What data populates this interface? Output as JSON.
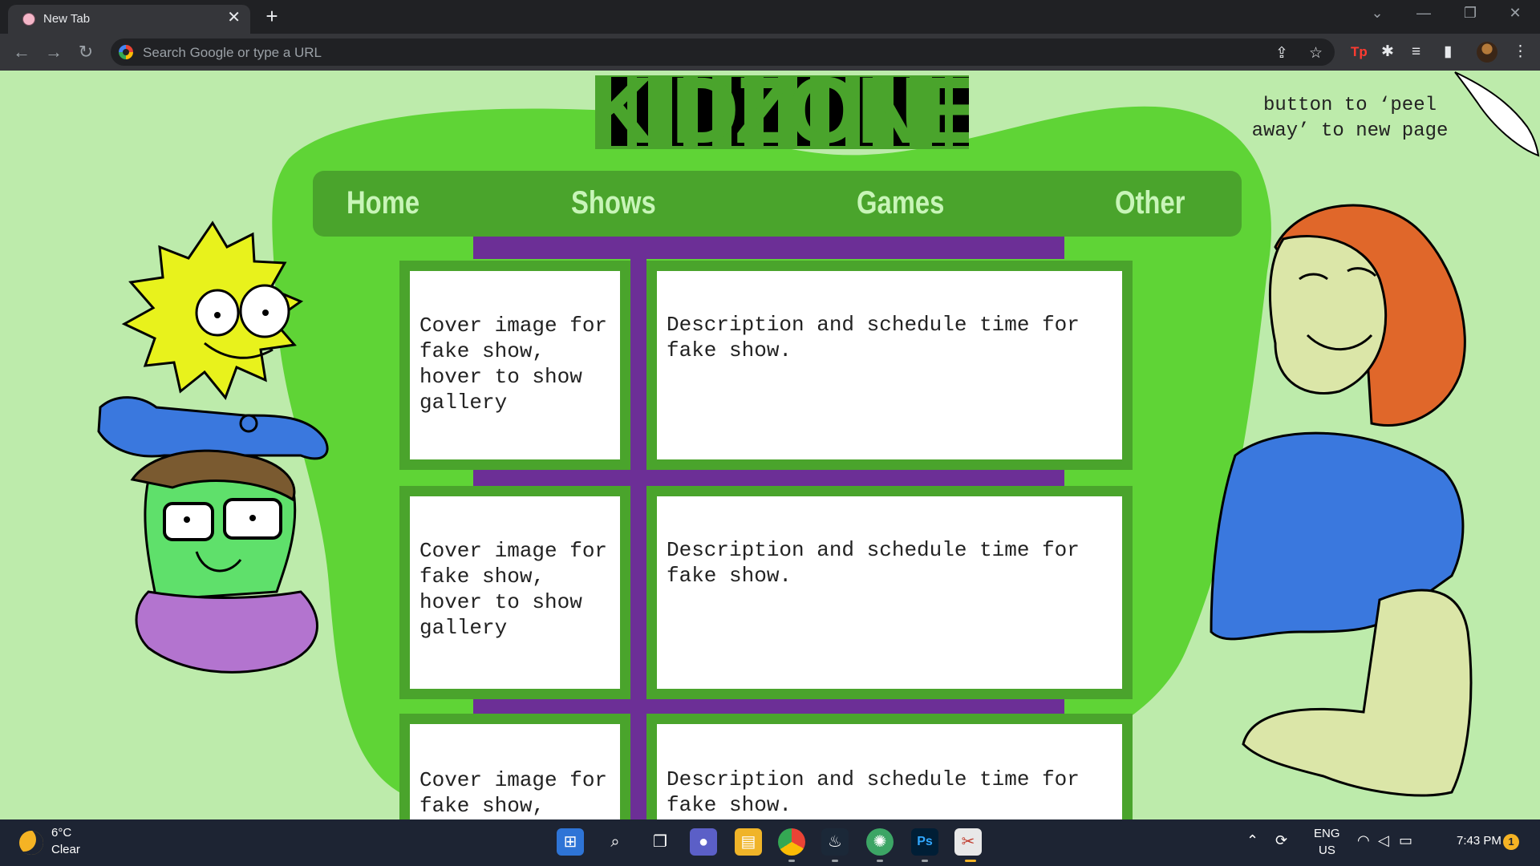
{
  "browser": {
    "tab_title": "New Tab",
    "tab_close": "✕",
    "new_tab": "+",
    "omnibox_placeholder": "Search Google or type a URL",
    "window_controls": [
      "⌄",
      "—",
      "❐",
      "✕"
    ]
  },
  "page": {
    "logo": "KIDZONE",
    "corner_note": "button to ‘peel away’ to new page",
    "nav": [
      "Home",
      "Shows",
      "Games",
      "Other"
    ],
    "cards": [
      {
        "cover": "Cover image for fake show, hover to show gallery",
        "description": "Description and schedule time for fake show."
      },
      {
        "cover": "Cover image for fake show, hover to show gallery",
        "description": "Description and schedule time for fake show."
      },
      {
        "cover": "Cover image for fake show,",
        "description": "Description and schedule time for fake show."
      }
    ],
    "colors": {
      "background": "#bdebab",
      "blob": "#5fd436",
      "panel": "#4aa42c",
      "accent": "#6c2f96"
    }
  },
  "taskbar": {
    "temp": "6°C",
    "weather": "Clear",
    "lang": "ENG",
    "region": "US",
    "time": "7:43 PM",
    "notifications": "1"
  }
}
